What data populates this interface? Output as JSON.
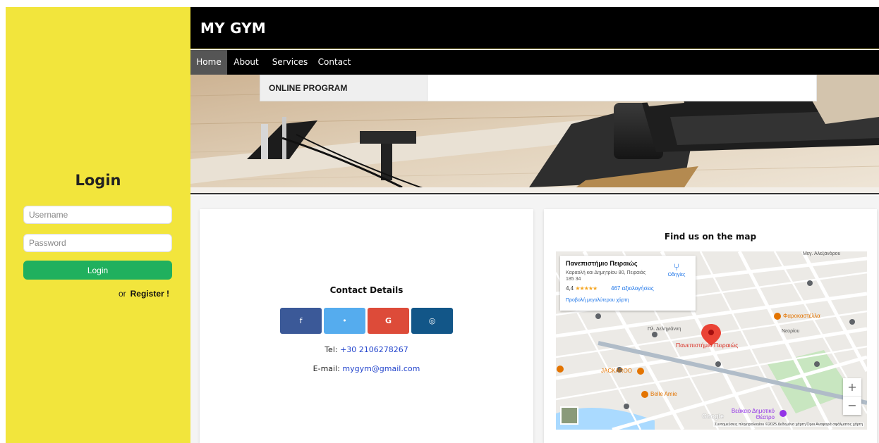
{
  "sidebar": {
    "title": "Login",
    "username_placeholder": "Username",
    "password_placeholder": "Password",
    "login_button": "Login",
    "register_or": "or",
    "register_link": "Register !"
  },
  "header": {
    "brand": "MY GYM"
  },
  "nav": {
    "items": [
      {
        "label": "Home"
      },
      {
        "label": "About"
      },
      {
        "label": "Services"
      },
      {
        "label": "Contact"
      }
    ],
    "dropdown_item": "ONLINE PROGRAM"
  },
  "contact": {
    "title": "Contact Details",
    "social": {
      "facebook": "f",
      "twitter": "•",
      "google": "G",
      "instagram": "◎"
    },
    "tel_label": "Tel:",
    "tel_value": "+30 2106278267",
    "email_label": "E-mail:",
    "email_value": "mygym@gmail.com"
  },
  "map": {
    "title": "Find us on the map",
    "place_name": "Πανεπιστήμιο Πειραιώς",
    "place_address": "Καραολή και Δημητρίου 80, Πειραιάς 185 34",
    "rating": "4,4",
    "stars": "★★★★★",
    "reviews": "467 αξιολογήσεις",
    "larger_map": "Προβολή μεγαλύτερου χάρτη",
    "directions": "Οδηγίες",
    "pin_label": "Πανεπιστήμιο Πειραιώς",
    "poi_farokastella": "Φαροκαστέλλα",
    "poi_jackaroo": "JACKAROO",
    "poi_belle": "Belle Amie",
    "poi_theatre": "Βεάκειο Δημοτικό Θέατρο",
    "street_deligianni": "Πλ. Δεληγιάννη",
    "street_neorion": "Νεορίου",
    "street_alexandrou": "Μεγ. Αλεξάνδρου",
    "google": "Google",
    "footer": "Συντομεύσεις πληκτρολογίου   ©2025 Δεδομένα χάρτη   Όροι   Αναφορά σφάλματος χάρτη",
    "zoom_in": "+",
    "zoom_out": "−"
  },
  "colors": {
    "sidebar": "#f2e53c",
    "header": "#000000",
    "login_button": "#20b05e",
    "facebook": "#3b5998",
    "twitter": "#55acee",
    "google": "#dd4b39",
    "instagram": "#125688"
  }
}
